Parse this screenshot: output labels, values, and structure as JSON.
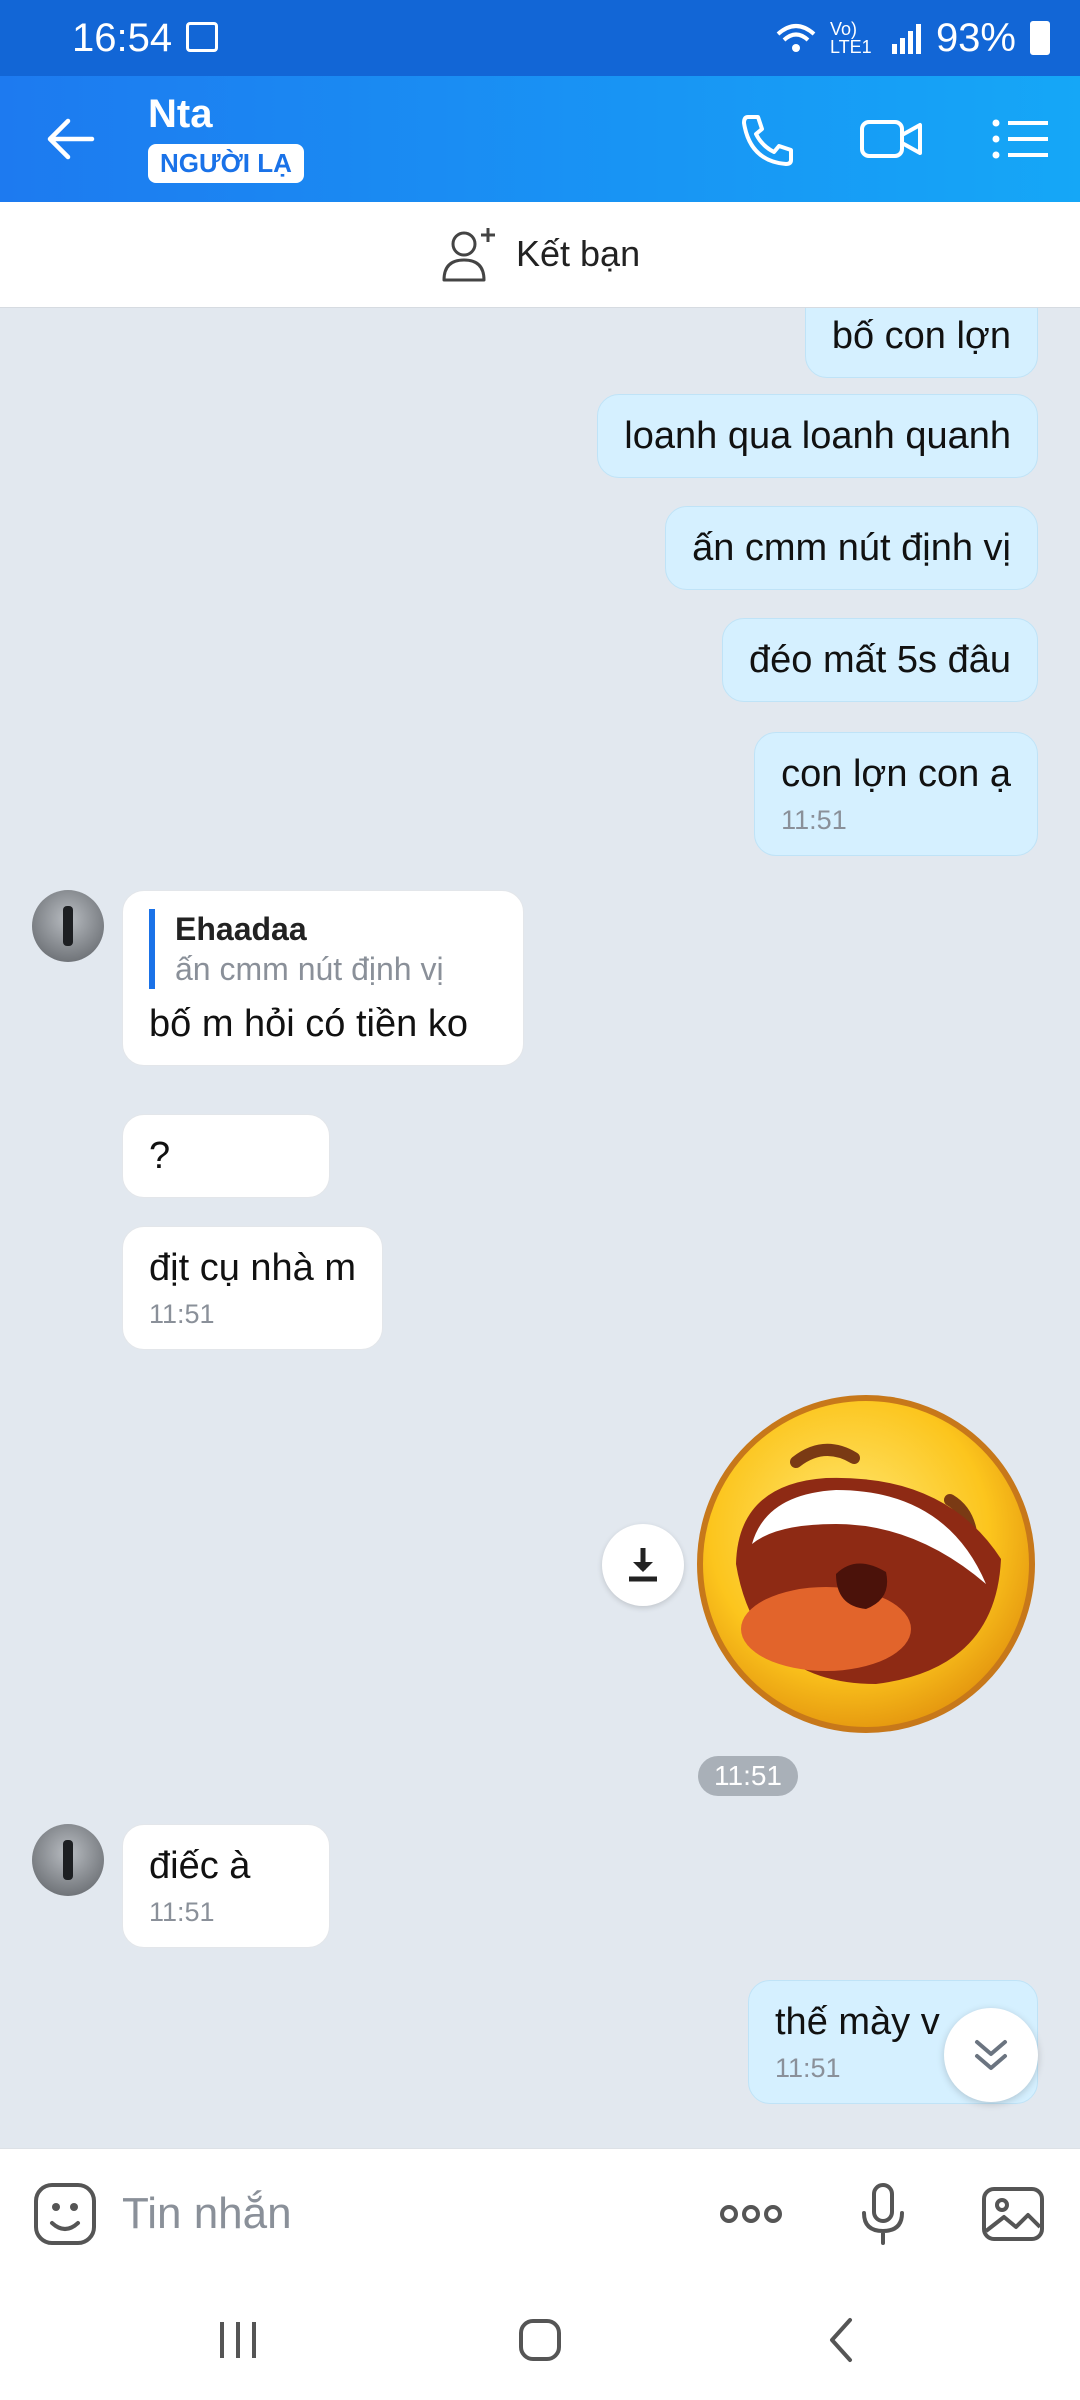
{
  "status": {
    "time": "16:54",
    "battery": "93%",
    "network": "Vo) LTE1"
  },
  "header": {
    "title": "Nta",
    "badge": "NGƯỜI LẠ"
  },
  "addfriend": {
    "label": "Kết bạn"
  },
  "messages": {
    "m1": "bố con lợn",
    "m2": "loanh qua loanh quanh",
    "m3": "ấn cmm nút định vị",
    "m4": "đéo mất 5s đâu",
    "m5": "con lợn con ạ",
    "m5_time": "11:51",
    "t1_quote_name": "Ehaadaa",
    "t1_quote_text": "ấn cmm nút định vị",
    "t1": "bố m hỏi có tiền ko",
    "t2": "?",
    "t3": "địt cụ nhà m",
    "t3_time": "11:51",
    "sticker_time": "11:51",
    "t4": "điếc à",
    "t4_time": "11:51",
    "m6": "thế mày v",
    "m6_time": "11:51"
  },
  "input": {
    "placeholder": "Tin nhắn"
  },
  "colors": {
    "header": "#1d7af0",
    "my_bubble": "#d5f0ff",
    "their_bubble": "#ffffff",
    "background": "#e2e8ef"
  }
}
